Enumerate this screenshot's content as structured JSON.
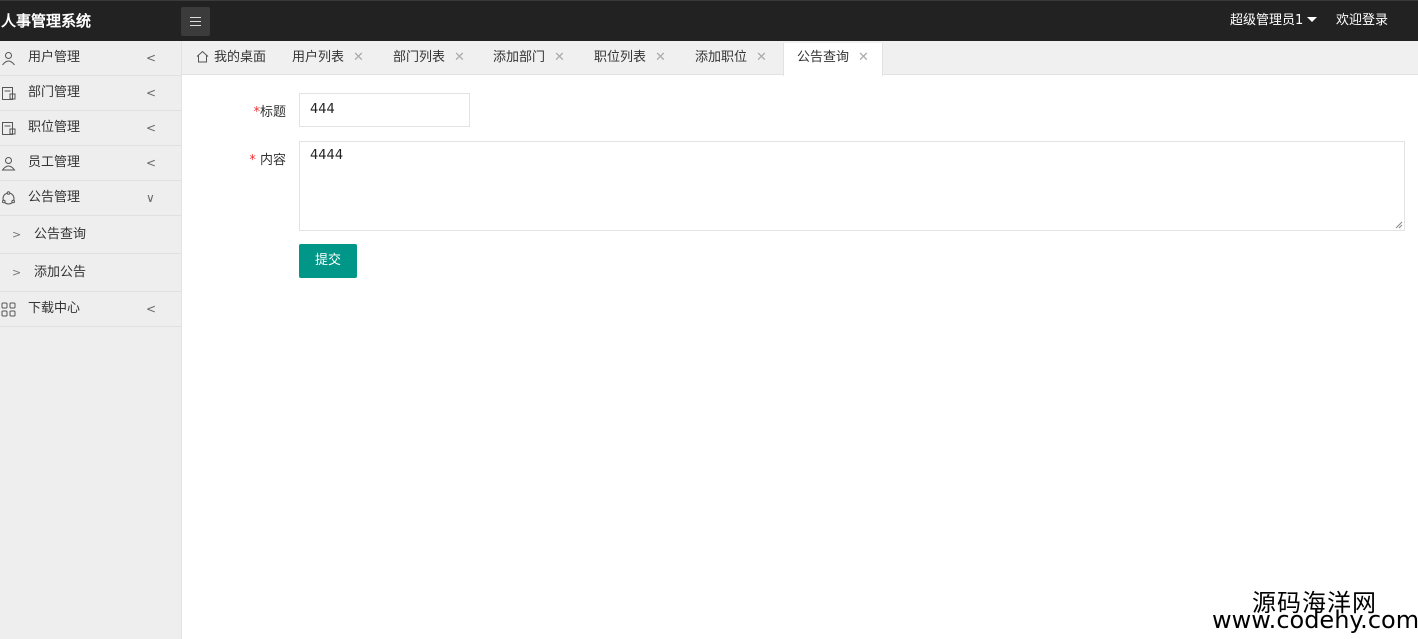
{
  "app": {
    "title": "人事管理系统"
  },
  "header": {
    "user_name": "超级管理员1",
    "welcome_link": "欢迎登录"
  },
  "sidebar": {
    "items": [
      {
        "label": "用户管理",
        "icon": "user-icon",
        "arrow": "<"
      },
      {
        "label": "部门管理",
        "icon": "org-icon",
        "arrow": "<"
      },
      {
        "label": "职位管理",
        "icon": "position-icon",
        "arrow": "<"
      },
      {
        "label": "员工管理",
        "icon": "employee-icon",
        "arrow": "<"
      },
      {
        "label": "公告管理",
        "icon": "notice-icon",
        "arrow": "∨"
      },
      {
        "label": "下载中心",
        "icon": "grid-icon",
        "arrow": "<"
      }
    ],
    "sub_items": [
      {
        "label": "公告查询",
        "chevron": ">"
      },
      {
        "label": "添加公告",
        "chevron": ">"
      }
    ]
  },
  "tabs": [
    {
      "label": "我的桌面",
      "closable": false
    },
    {
      "label": "用户列表",
      "closable": true
    },
    {
      "label": "部门列表",
      "closable": true
    },
    {
      "label": "添加部门",
      "closable": true
    },
    {
      "label": "职位列表",
      "closable": true
    },
    {
      "label": "添加职位",
      "closable": true
    },
    {
      "label": "公告查询",
      "closable": true,
      "active": true
    }
  ],
  "tab_close_glyph": "✕",
  "form": {
    "title_label": "标题",
    "title_required": "*",
    "title_value": "444",
    "content_label": "内容",
    "content_required": "* ",
    "content_value": "4444",
    "submit_label": "提交"
  },
  "watermark": {
    "line1": "源码海洋网",
    "line2": "www.codehy.com"
  },
  "colors": {
    "header_bg": "#222222",
    "sidebar_bg": "#eeeeee",
    "accent": "#009688",
    "required": "#ee3333"
  }
}
